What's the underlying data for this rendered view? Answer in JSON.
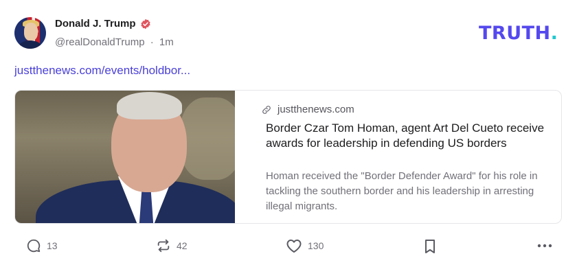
{
  "author": {
    "display_name": "Donald J. Trump",
    "handle": "@realDonaldTrump",
    "separator": "·",
    "timestamp": "1m",
    "verified_icon": "verified-badge-icon"
  },
  "brand": {
    "logo_main": "TRUTH",
    "logo_dot": ".",
    "logo_color": "#5448ee",
    "dot_color": "#20c8d0"
  },
  "post": {
    "link_text": "justthenews.com/events/holdbor..."
  },
  "link_card": {
    "domain": "justthenews.com",
    "title": "Border Czar Tom Homan, agent Art Del Cueto receive awards for leadership in defending US borders",
    "description": "Homan received the \"Border Defender Award\" for his role in tackling the southern border and his leadership in arresting illegal migrants."
  },
  "actions": {
    "reply_count": "13",
    "retruth_count": "42",
    "like_count": "130"
  },
  "colors": {
    "link": "#4a40d8",
    "muted": "#707078",
    "verified": "#e0545e"
  }
}
